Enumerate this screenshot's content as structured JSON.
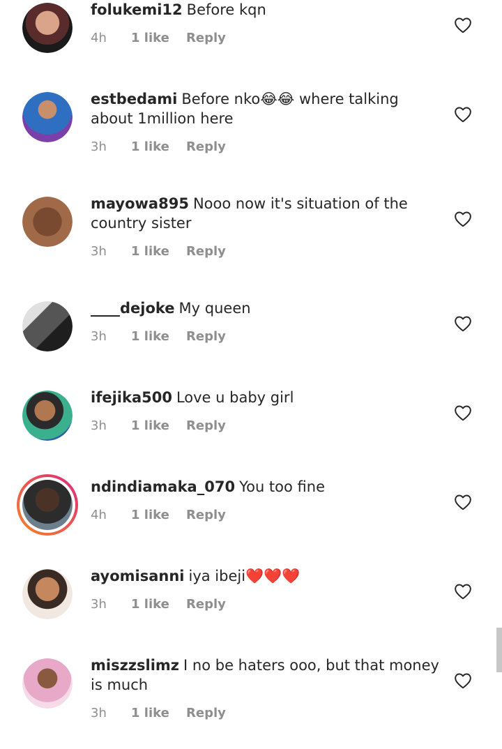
{
  "comments": [
    {
      "username": "folukemi12",
      "text": "Before kqn",
      "time": "4h",
      "likes": "1 like",
      "reply": "Reply"
    },
    {
      "username": "estbedami",
      "text": "Before nko😂😂 where talking about 1million here",
      "time": "3h",
      "likes": "1 like",
      "reply": "Reply"
    },
    {
      "username": "mayowa895",
      "text": "Nooo now it's situation of the country sister",
      "time": "3h",
      "likes": "1 like",
      "reply": "Reply"
    },
    {
      "username": "____dejoke",
      "text": "My queen",
      "time": "3h",
      "likes": "1 like",
      "reply": "Reply"
    },
    {
      "username": "ifejika500",
      "text": "Love u baby girl",
      "time": "3h",
      "likes": "1 like",
      "reply": "Reply"
    },
    {
      "username": "ndindiamaka_070",
      "text": "You too fine",
      "time": "4h",
      "likes": "1 like",
      "reply": "Reply"
    },
    {
      "username": "ayomisanni",
      "text": "iya ibeji❤️❤️❤️",
      "time": "3h",
      "likes": "1 like",
      "reply": "Reply"
    },
    {
      "username": "miszzslimz",
      "text": "I no be haters ooo, but that money is much",
      "time": "3h",
      "likes": "1 like",
      "reply": "Reply"
    }
  ],
  "colors": {
    "text": "#262626",
    "meta": "#8e8e8e",
    "story_ring_start": "#f58529",
    "story_ring_end": "#dd2a7b"
  },
  "icons": {
    "like": "heart-outline-icon"
  }
}
